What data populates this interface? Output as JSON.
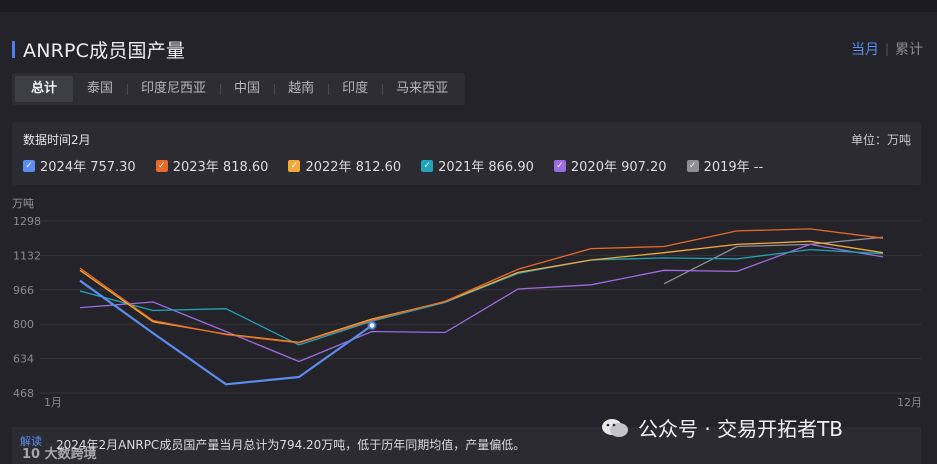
{
  "header": {
    "title": "ANRPC成员国产量",
    "mode_on": "当月",
    "mode_off": "累计"
  },
  "tabs": [
    "总计",
    "泰国",
    "印度尼西亚",
    "中国",
    "越南",
    "印度",
    "马来西亚"
  ],
  "panel": {
    "time_label": "数据时间2月",
    "unit_label": "单位：万吨"
  },
  "legend": [
    {
      "label": "2024年 757.30",
      "color": "#5b8def"
    },
    {
      "label": "2023年 818.60",
      "color": "#e8692a"
    },
    {
      "label": "2022年 812.60",
      "color": "#f2a93b"
    },
    {
      "label": "2021年 866.90",
      "color": "#1fa5b8"
    },
    {
      "label": "2020年 907.20",
      "color": "#9c6ce0"
    },
    {
      "label": "2019年 --",
      "color": "#8e8e96"
    }
  ],
  "footer": {
    "badge": "解读",
    "text": "2024年2月ANRPC成员国产量当月总计为794.20万吨，低于历年同期均值，产量偏低。",
    "brand": "10 大数跨境"
  },
  "watermark": "公众号 · 交易开拓者TB",
  "chart_data": {
    "type": "line",
    "yunit": "万吨",
    "x": [
      1,
      2,
      3,
      4,
      5,
      6,
      7,
      8,
      9,
      10,
      11,
      12
    ],
    "x_tick_labels": {
      "first": "1月",
      "last": "12月"
    },
    "y_ticks": [
      468,
      634,
      800,
      966,
      1132,
      1298
    ],
    "ylim": [
      468,
      1298
    ],
    "grid": true,
    "series": [
      {
        "name": "2024年",
        "color": "#5b8def",
        "values": [
          1010,
          757,
          510,
          545,
          794,
          null,
          null,
          null,
          null,
          null,
          null,
          null
        ]
      },
      {
        "name": "2023年",
        "color": "#e8692a",
        "values": [
          1070,
          818,
          750,
          710,
          820,
          910,
          1065,
          1165,
          1175,
          1250,
          1260,
          1215
        ]
      },
      {
        "name": "2022年",
        "color": "#f2a93b",
        "values": [
          1060,
          812,
          752,
          712,
          825,
          908,
          1050,
          1110,
          1145,
          1185,
          1200,
          1145
        ]
      },
      {
        "name": "2021年",
        "color": "#1fa5b8",
        "values": [
          960,
          866,
          875,
          700,
          815,
          905,
          1045,
          1110,
          1120,
          1115,
          1160,
          1140
        ]
      },
      {
        "name": "2020年",
        "color": "#9c6ce0",
        "values": [
          880,
          907,
          765,
          620,
          765,
          760,
          970,
          990,
          1060,
          1055,
          1185,
          1125
        ]
      },
      {
        "name": "2019年",
        "color": "#8e8e96",
        "values": [
          null,
          null,
          null,
          null,
          null,
          null,
          null,
          null,
          995,
          1175,
          1185,
          1220
        ]
      }
    ],
    "highlight_point": {
      "series": "2024年",
      "x": 5,
      "value": 794
    }
  }
}
